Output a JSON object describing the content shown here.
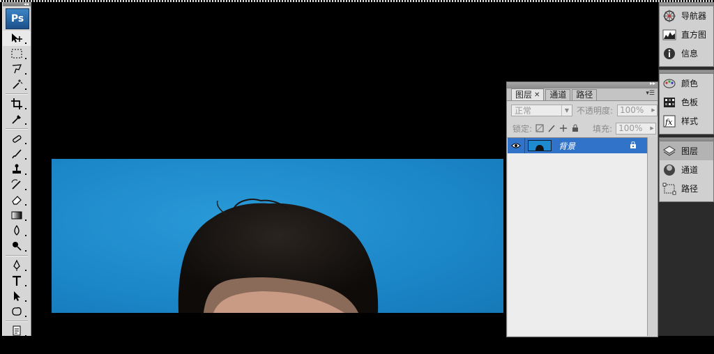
{
  "app": {
    "logo": "Ps"
  },
  "toolbox": {
    "tools": [
      "move-tool-icon",
      "marquee-tool-icon",
      "lasso-tool-icon",
      "magic-wand-tool-icon",
      "crop-tool-icon",
      "eyedropper-tool-icon",
      "healing-brush-tool-icon",
      "brush-tool-icon",
      "clone-stamp-tool-icon",
      "history-brush-tool-icon",
      "eraser-tool-icon",
      "gradient-tool-icon",
      "blur-tool-icon",
      "dodge-tool-icon",
      "pen-tool-icon",
      "type-tool-icon",
      "path-selection-tool-icon",
      "custom-shape-tool-icon",
      "notes-tool-icon",
      "eyedropper2-tool-icon"
    ]
  },
  "layers_panel": {
    "tabs": [
      {
        "label": "图层",
        "active": true,
        "closable": true
      },
      {
        "label": "通道",
        "active": false
      },
      {
        "label": "路径",
        "active": false
      }
    ],
    "blend_mode": "正常",
    "opacity_label": "不透明度:",
    "opacity_value": "100%",
    "lock_label": "锁定:",
    "fill_label": "填充:",
    "fill_value": "100%",
    "layers": [
      {
        "name": "背景",
        "visible": true,
        "locked": true,
        "selected": true
      }
    ]
  },
  "dock": {
    "groups": [
      [
        {
          "label": "导航器",
          "icon": "navigator-icon"
        },
        {
          "label": "直方图",
          "icon": "histogram-icon"
        },
        {
          "label": "信息",
          "icon": "info-icon"
        }
      ],
      [
        {
          "label": "颜色",
          "icon": "color-palette-icon"
        },
        {
          "label": "色板",
          "icon": "swatches-icon"
        },
        {
          "label": "样式",
          "icon": "styles-icon"
        }
      ],
      [
        {
          "label": "图层",
          "icon": "layers-icon",
          "active": true
        },
        {
          "label": "通道",
          "icon": "channels-icon"
        },
        {
          "label": "路径",
          "icon": "paths-icon"
        }
      ]
    ]
  },
  "colors": {
    "canvas_background": "#000000",
    "image_background": "#1b86c8",
    "selection": "#3173c8",
    "panel": "#d4d4d4"
  }
}
